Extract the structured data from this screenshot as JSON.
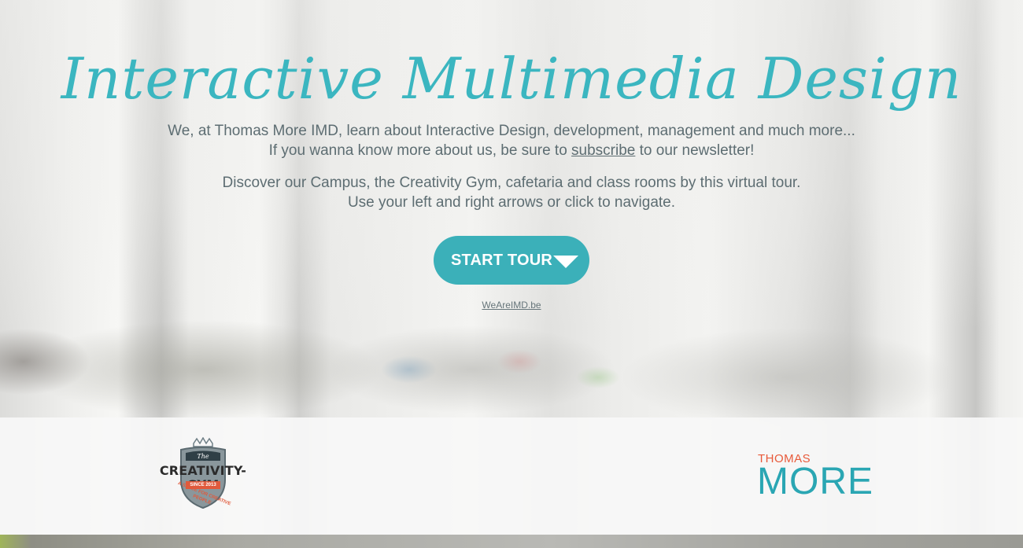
{
  "hero": {
    "title": "Interactive Multimedia Design",
    "intro_line1": "We, at Thomas More IMD, learn about Interactive Design, development, management and much more...",
    "intro_line2_before": "If you wanna know more about us, be sure to ",
    "intro_line2_link": "subscribe",
    "intro_line2_after": " to our newsletter!",
    "tour_line1": "Discover our Campus, the Creativity Gym, cafetaria and class rooms by this virtual tour.",
    "tour_line2": "Use your left and right arrows or click to navigate."
  },
  "start_tour": {
    "label": "START TOUR",
    "icon": "triangle-down-icon"
  },
  "site_link": {
    "label": "WeAreIMD.be"
  },
  "footer": {
    "creativity_gym_logo": {
      "text": "CREATIVITY-GYM",
      "since": "SINCE 2013",
      "tagline": "A SPACE FOR CREATIVE PEOPLE"
    },
    "thomas_more_logo": {
      "top": "THOMAS",
      "bottom": "MORE"
    }
  },
  "colors": {
    "accent": "#3bb6c0",
    "button": "#3bb0b9",
    "body_text": "#5d6d72",
    "brand_orange": "#e85a3a"
  }
}
